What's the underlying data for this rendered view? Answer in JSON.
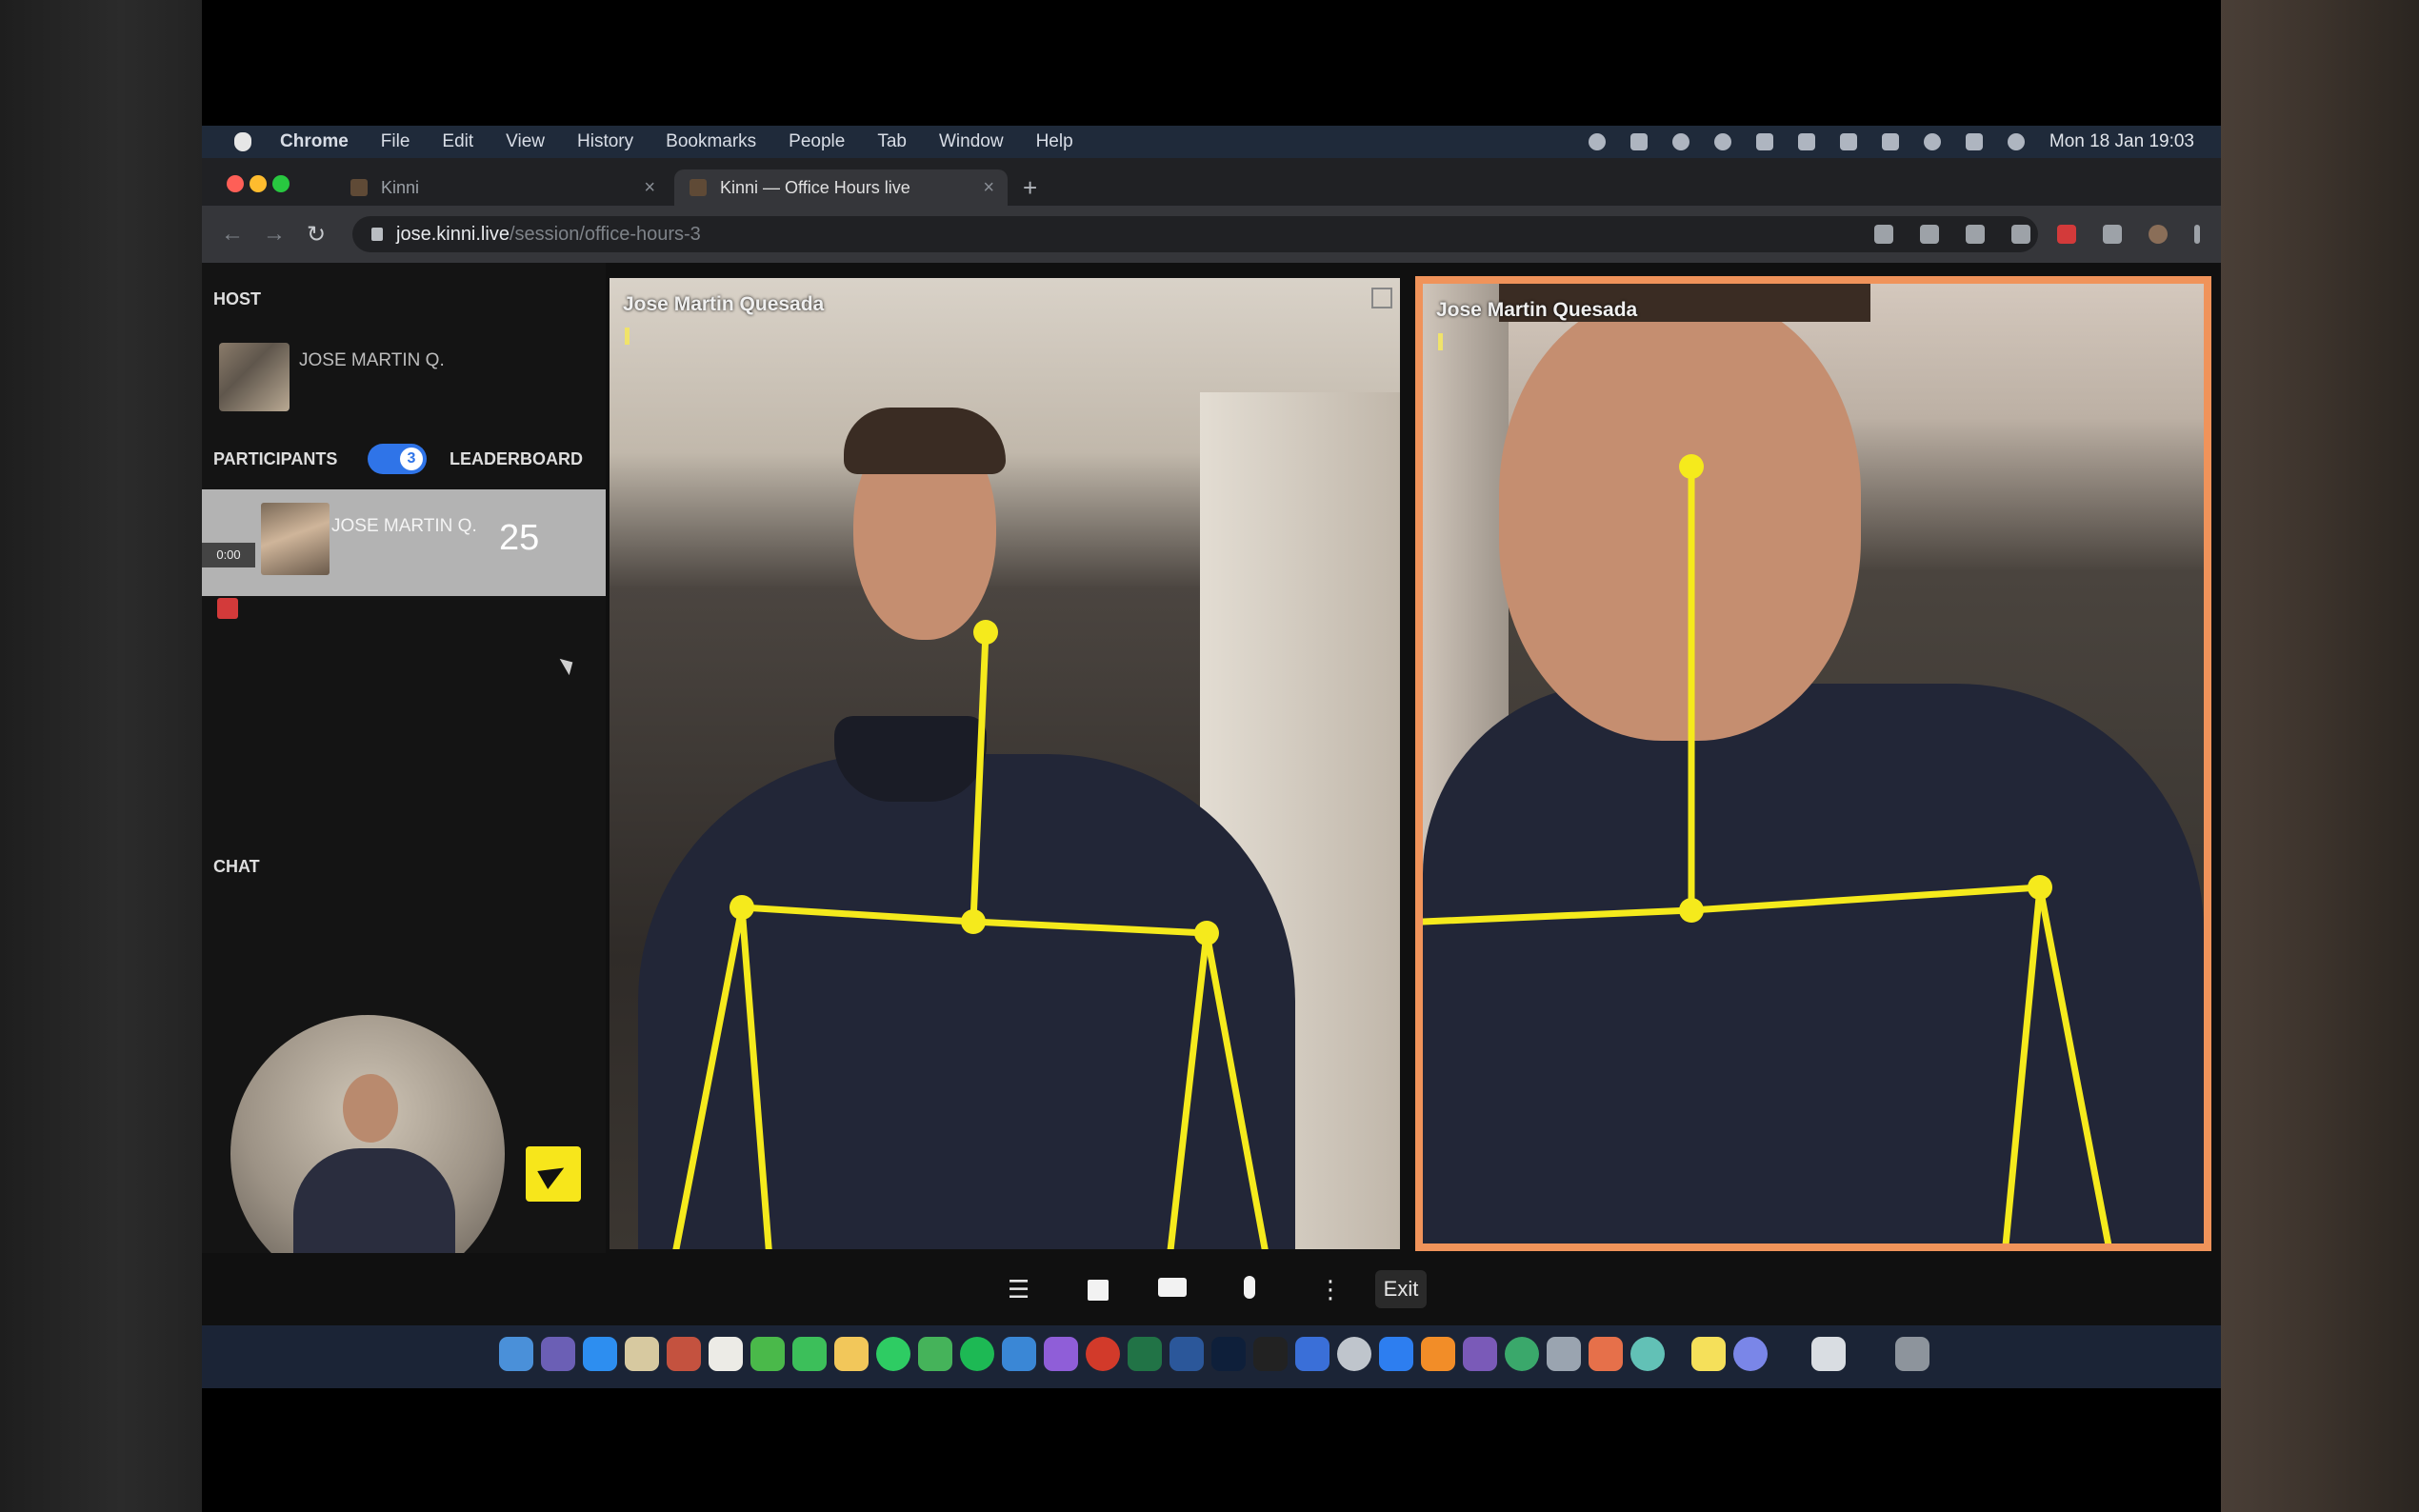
{
  "menubar": {
    "items": [
      "Chrome",
      "File",
      "Edit",
      "View",
      "History",
      "Bookmarks",
      "People",
      "Tab",
      "Window",
      "Help"
    ],
    "clock": "Mon 18 Jan 19:03"
  },
  "tabs": [
    {
      "title": "Kinni",
      "active": false
    },
    {
      "title": "Kinni — Office Hours live",
      "active": true
    }
  ],
  "address": {
    "host": "jose.kinni.live",
    "path": "/session/office-hours-3"
  },
  "sidebar": {
    "host_label": "HOST",
    "host_name": "JOSE MARTIN Q.",
    "participants_label": "PARTICIPANTS",
    "participants_count": "3",
    "leaderboard_label": "LEADERBOARD",
    "participant": {
      "tag": "0:00",
      "name": "JOSE MARTIN Q.",
      "score": "25"
    },
    "chat_label": "CHAT"
  },
  "videos": [
    {
      "name": "Jose Martin Quesada"
    },
    {
      "name": "Jose Martin Quesada"
    }
  ],
  "controls": {
    "exit_label": "Exit"
  },
  "colors": {
    "accent": "#f7e61b",
    "highlight_border": "#f0935a",
    "skeleton": "#f5ea1c",
    "toggle": "#2f74e8"
  }
}
